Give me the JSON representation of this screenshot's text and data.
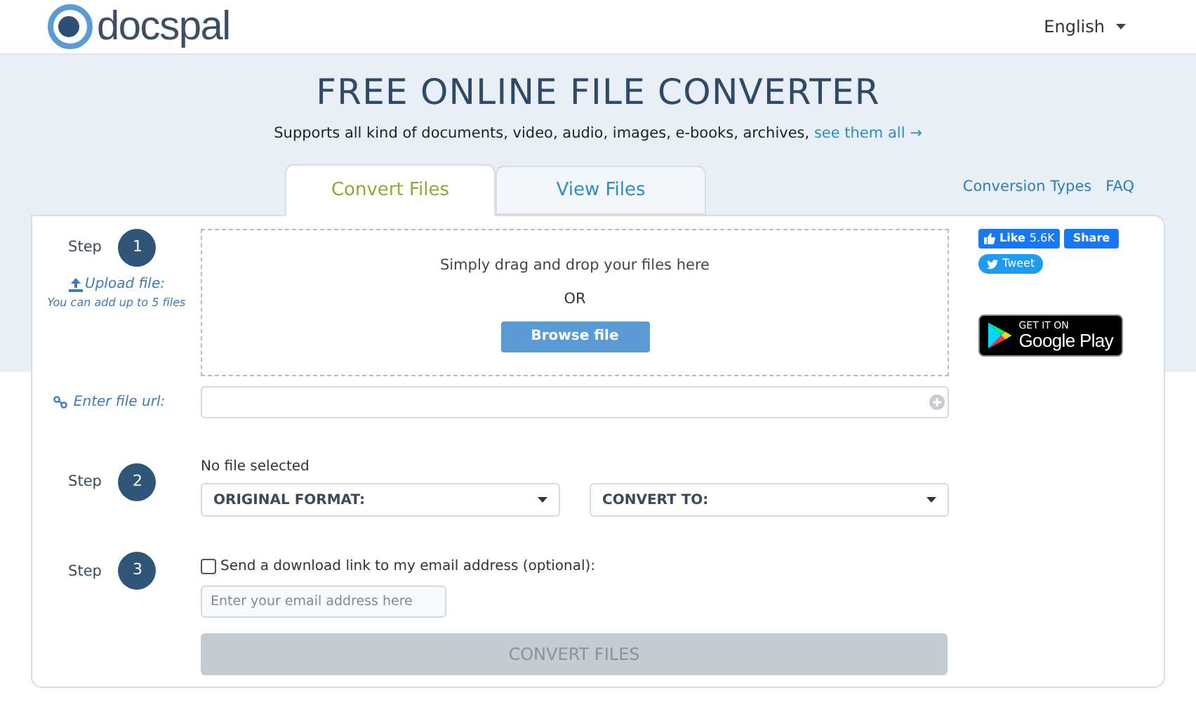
{
  "header": {
    "logo_text": "docspal",
    "language": "English"
  },
  "hero": {
    "title": "FREE ONLINE FILE CONVERTER",
    "subtitle": "Supports all kind of documents, video, audio, images, e-books, archives, ",
    "subtitle_link": "see them all →"
  },
  "tabs": [
    {
      "label": "Convert Files",
      "selected": true
    },
    {
      "label": "View Files",
      "selected": false
    }
  ],
  "top_links": [
    "Conversion Types",
    "FAQ"
  ],
  "step1": {
    "step_label": "Step",
    "number": "1",
    "upload_label": "Upload file:",
    "upload_hint": "You can add up to 5 files",
    "drop_text": "Simply drag and drop your files here",
    "or_text": "OR",
    "browse_button": "Browse file",
    "url_label": "Enter file url:"
  },
  "step2": {
    "step_label": "Step",
    "number": "2",
    "status": "No file selected",
    "original_format": "ORIGINAL FORMAT:",
    "convert_to": "CONVERT TO:"
  },
  "step3": {
    "step_label": "Step",
    "number": "3",
    "email_checkbox": {
      "label": "Send a download link to my email address (optional):",
      "checked": false
    },
    "email_placeholder": "Enter your email address here",
    "convert_button": {
      "label": "CONVERT FILES",
      "disabled": true
    }
  },
  "social": {
    "like": "Like",
    "like_count": "5.6K",
    "share": "Share",
    "tweet": "Tweet"
  },
  "store_badge": {
    "small": "GET IT ON",
    "large": "Google Play"
  }
}
